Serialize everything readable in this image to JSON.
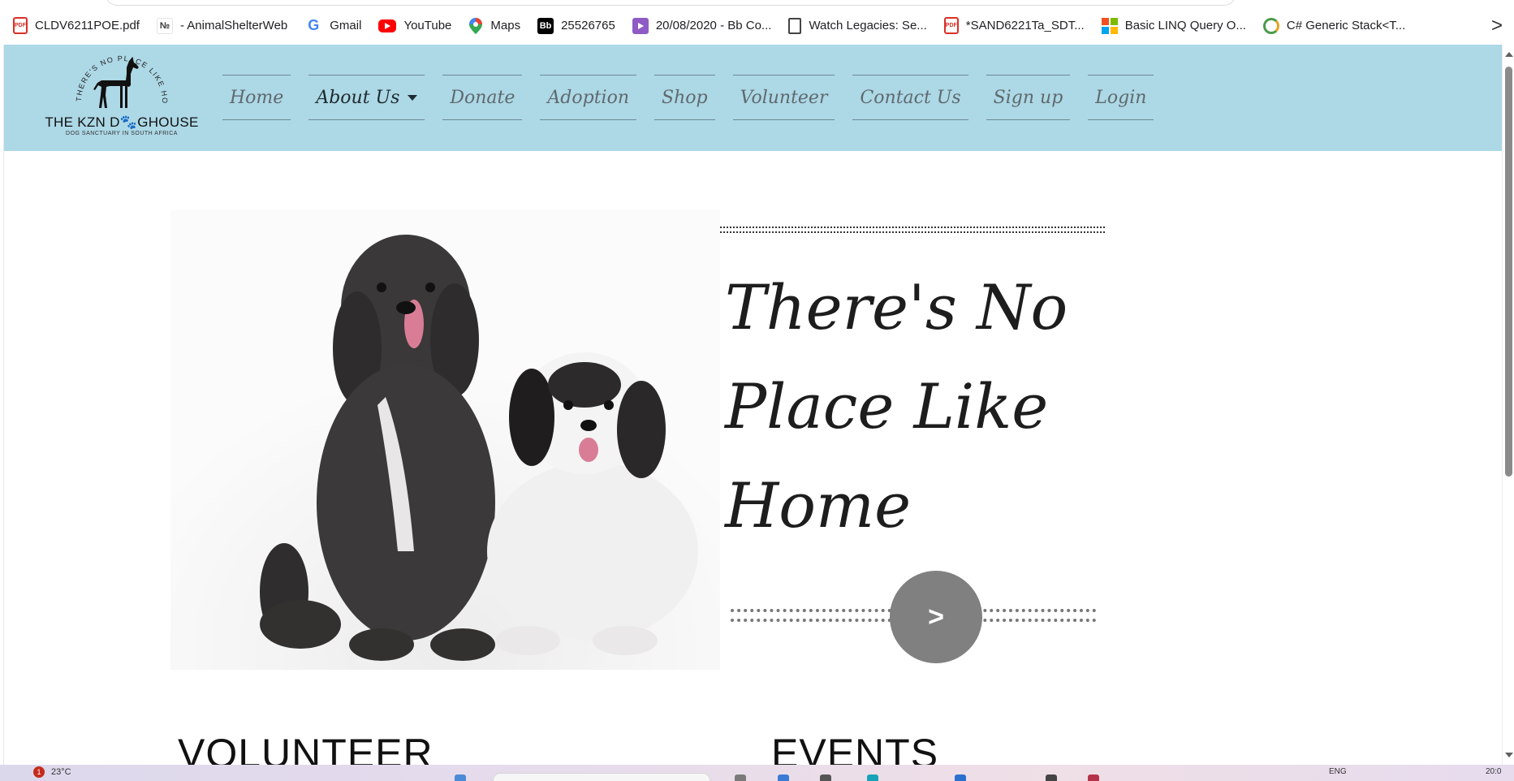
{
  "bookmarks": [
    {
      "label": "CLDV6211POE.pdf",
      "icon": "pdf-icon"
    },
    {
      "label": "- AnimalShelterWeb",
      "icon": "page-icon"
    },
    {
      "label": "Gmail",
      "icon": "google-icon"
    },
    {
      "label": "YouTube",
      "icon": "youtube-icon"
    },
    {
      "label": "Maps",
      "icon": "maps-icon"
    },
    {
      "label": "25526765",
      "icon": "bb-icon"
    },
    {
      "label": "20/08/2020 - Bb Co...",
      "icon": "video-icon"
    },
    {
      "label": "Watch Legacies: Se...",
      "icon": "document-icon"
    },
    {
      "label": "*SAND6221Ta_SDT...",
      "icon": "pdf-icon"
    },
    {
      "label": "Basic LINQ Query O...",
      "icon": "microsoft-icon"
    },
    {
      "label": "C# Generic Stack<T...",
      "icon": "site-icon"
    }
  ],
  "bookmarks_more": ">",
  "site": {
    "logo_title": "THE KZN D🐾GHOUSE",
    "logo_arc_text": "THERE'S NO PLACE LIKE HOME",
    "logo_subtitle": "DOG SANCTUARY IN SOUTH AFRICA",
    "navbar_color": "#add8e6",
    "nav": [
      {
        "label": "Home"
      },
      {
        "label": "About Us",
        "dropdown": true
      },
      {
        "label": "Donate"
      },
      {
        "label": "Adoption"
      },
      {
        "label": "Shop"
      },
      {
        "label": "Volunteer"
      },
      {
        "label": "Contact Us"
      },
      {
        "label": "Sign up"
      },
      {
        "label": "Login"
      }
    ]
  },
  "hero": {
    "headline_lines": [
      "There's No",
      "Place Like",
      "Home"
    ],
    "next_button": ">",
    "image": "two-dogs-photo"
  },
  "sections": {
    "volunteer_heading": "VOLUNTEER",
    "events_heading": "EVENTS"
  },
  "taskbar": {
    "badge": "1",
    "weather": "23°C",
    "lang": "ENG",
    "time": "20:0"
  }
}
